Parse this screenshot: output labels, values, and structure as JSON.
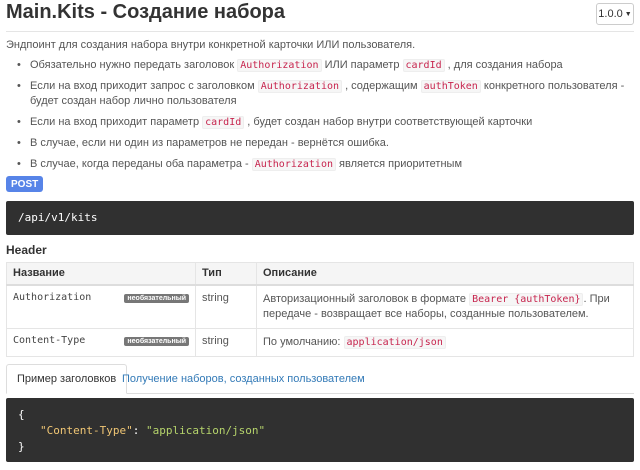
{
  "header": {
    "title": "Main.Kits - Создание набора",
    "version": "1.0.0"
  },
  "description": "Эндпоинт для создания набора внутри конкретной карточки ИЛИ пользователя.",
  "bullets": [
    {
      "parts": [
        "Обязательно нужно передать заголовок ",
        "Authorization",
        " ИЛИ параметр ",
        "cardId",
        " , для создания набора"
      ]
    },
    {
      "parts": [
        "Если на вход приходит запрос с заголовком ",
        "Authorization",
        " , содержащим ",
        "authToken",
        " конкретного пользователя - будет создан набор лично пользователя"
      ]
    },
    {
      "parts": [
        "Если на вход приходит параметр ",
        "cardId",
        " , будет создан набор внутри соответствующей карточки"
      ]
    },
    {
      "text": "В случае, если ни один из параметров не передан - вернётся ошибка."
    },
    {
      "parts": [
        "В случае, когда переданы оба параметра - ",
        "Authorization",
        " является приоритетным"
      ]
    }
  ],
  "method": "POST",
  "endpoint": "/api/v1/kits",
  "section_title": "Header",
  "table": {
    "columns": [
      "Название",
      "Тип",
      "Описание"
    ],
    "rows": [
      {
        "name": "Authorization",
        "badge": "необязательный",
        "type": "string",
        "desc_before": "Авторизационный заголовок в формате ",
        "desc_code": "Bearer {authToken}",
        "desc_after": ". При передаче - возвращает все наборы, созданные пользователем."
      },
      {
        "name": "Content-Type",
        "badge": "необязательный",
        "type": "string",
        "desc_before": "По умолчанию: ",
        "desc_code": "application/json",
        "desc_after": ""
      }
    ]
  },
  "tabs": {
    "active": "Пример заголовков",
    "other": "Получение наборов, созданных пользователем"
  },
  "code": {
    "open": "{",
    "key": "\"Content-Type\"",
    "colon": ": ",
    "value": "\"application/json\"",
    "close": "}"
  }
}
